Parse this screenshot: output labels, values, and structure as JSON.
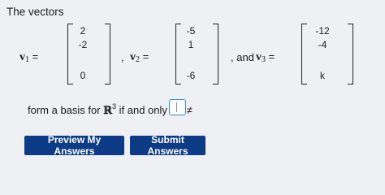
{
  "intro_text": "The vectors",
  "vectors": [
    {
      "name": "v",
      "sub": "1",
      "entries": [
        "2",
        "-2",
        "",
        "0"
      ]
    },
    {
      "name": "v",
      "sub": "2",
      "entries": [
        "-5",
        "1",
        "",
        "-6"
      ]
    },
    {
      "name": "v",
      "sub": "3",
      "entries": [
        "-12",
        "-4",
        "",
        "k"
      ]
    }
  ],
  "separators": {
    "eq": "=",
    "comma_v2": ", ",
    "and_v3": ", and "
  },
  "statement": {
    "prefix": "form a basis for ",
    "space": "ℝ",
    "dim": "3",
    "suffix": " if and only if ",
    "var": "k",
    "neq": "≠",
    "end": "."
  },
  "answer": {
    "value": ""
  },
  "buttons": {
    "preview": "Preview My Answers",
    "submit": "Submit Answers"
  },
  "colors": {
    "button_bg": "#0d3b86",
    "input_border": "#2f8fd8"
  }
}
